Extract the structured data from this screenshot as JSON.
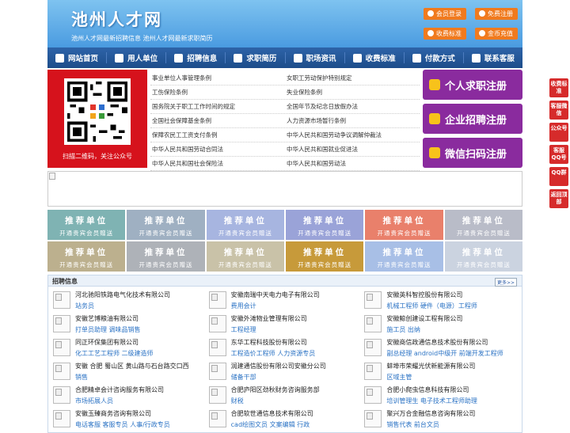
{
  "header": {
    "logo": "池州人才网",
    "subtitle": "池州人才网最新招聘信息   池州人才网最新求职简历",
    "buttons": [
      "会员登录",
      "免费注册",
      "收费标准",
      "金币充值"
    ],
    "accent_color": "#f07a1e"
  },
  "nav": {
    "items": [
      {
        "label": "网站首页",
        "icon": "home-icon"
      },
      {
        "label": "用人单位",
        "icon": "building-icon"
      },
      {
        "label": "招聘信息",
        "icon": "megaphone-icon"
      },
      {
        "label": "求职简历",
        "icon": "resume-icon"
      },
      {
        "label": "职场资讯",
        "icon": "news-icon"
      },
      {
        "label": "收费标准",
        "icon": "list-icon"
      },
      {
        "label": "付款方式",
        "icon": "wallet-icon"
      },
      {
        "label": "联系客服",
        "icon": "phone-icon"
      }
    ]
  },
  "qr": {
    "caption": "扫描二维码，关注公众号"
  },
  "laws": [
    [
      "事业单位人事管理条例",
      "女职工劳动保护特别规定"
    ],
    [
      "工伤保险条例",
      "失业保险条例"
    ],
    [
      "国务院关于职工工作时间的规定",
      "全国年节及纪念日放假办法"
    ],
    [
      "全国社会保障基金条例",
      "人力资源市场暂行条例"
    ],
    [
      "保障农民工工资支付条例",
      "中华人民共和国劳动争议调解仲裁法"
    ],
    [
      "中华人民共和国劳动合同法",
      "中华人民共和国就业促进法"
    ],
    [
      "中华人民共和国社会保险法",
      "中华人民共和国劳动法"
    ]
  ],
  "register": [
    {
      "label": "个人求职注册",
      "color": "#8a2b9e"
    },
    {
      "label": "企业招聘注册",
      "color": "#8a2b9e"
    },
    {
      "label": "微信扫码注册",
      "color": "#8a2b9e"
    }
  ],
  "tiles": {
    "title": "推荐单位",
    "sub": "开通贵宾会员赠送",
    "colors": [
      "#7fb3b3",
      "#9fb0c2",
      "#a7b5e0",
      "#9aa3d8",
      "#e9806b",
      "#b9bcc8",
      "#bcb08e",
      "#aeb2b8",
      "#c9c2a8",
      "#c79a3a",
      "#a8bfe6",
      "#cbd3e0"
    ]
  },
  "jobs": {
    "title": "招聘信息",
    "more": "更多>>",
    "items": [
      {
        "company": "河北驰阳铁路电气化技术有限公司",
        "positions": "站务员"
      },
      {
        "company": "安徽南瑞中天电力电子有限公司",
        "positions": "费用会计"
      },
      {
        "company": "安徽英科智控股份有限公司",
        "positions": "机械工程师 硬件（电源）工程师"
      },
      {
        "company": "安徽艺博粮油有限公司",
        "positions": "打单员助理 调味品销售"
      },
      {
        "company": "安徽外滩物业管理有限公司",
        "positions": "工程经理"
      },
      {
        "company": "安徽鲸创建设工程有限公司",
        "positions": "施工员 出纳"
      },
      {
        "company": "同正环保集团有限公司",
        "positions": "化工工艺工程师 二级建造师"
      },
      {
        "company": "东华工程科技股份有限公司",
        "positions": "工程造价工程师 人力资源专员"
      },
      {
        "company": "安徽商信政通信息技术股份有限公司",
        "positions": "副总经理 android中级开 前端开发工程师"
      },
      {
        "company": "安徽 合肥 蜀山区 黄山路与石台路交口西",
        "positions": "销售"
      },
      {
        "company": "润建通信股份有限公司安徽分公司",
        "positions": "储备干部"
      },
      {
        "company": "蚌埠市荣耀光伏新能源有限公司",
        "positions": "区域主管"
      },
      {
        "company": "合肥精卓会计咨询服务有限公司",
        "positions": "市场拓展人员"
      },
      {
        "company": "合肥庐阳区劲秋财务咨询服务部",
        "positions": "财税"
      },
      {
        "company": "合肥小爬虫信息科技有限公司",
        "positions": "培训管理生 电子技术工程师助理"
      },
      {
        "company": "安徽玉臻商务咨询有限公司",
        "positions": "电话客服 客服专员 人事/行政专员"
      },
      {
        "company": "合肥软世通信息技术有限公司",
        "positions": "cad绘图文员 文案编辑 行政"
      },
      {
        "company": "聚兴万合金融信息咨询有限公司",
        "positions": "销售代表 前台文员"
      }
    ]
  },
  "side": [
    "收费标准",
    "客服微信",
    "公众号",
    "客服QQ号",
    "QQ群",
    "返回顶部"
  ]
}
